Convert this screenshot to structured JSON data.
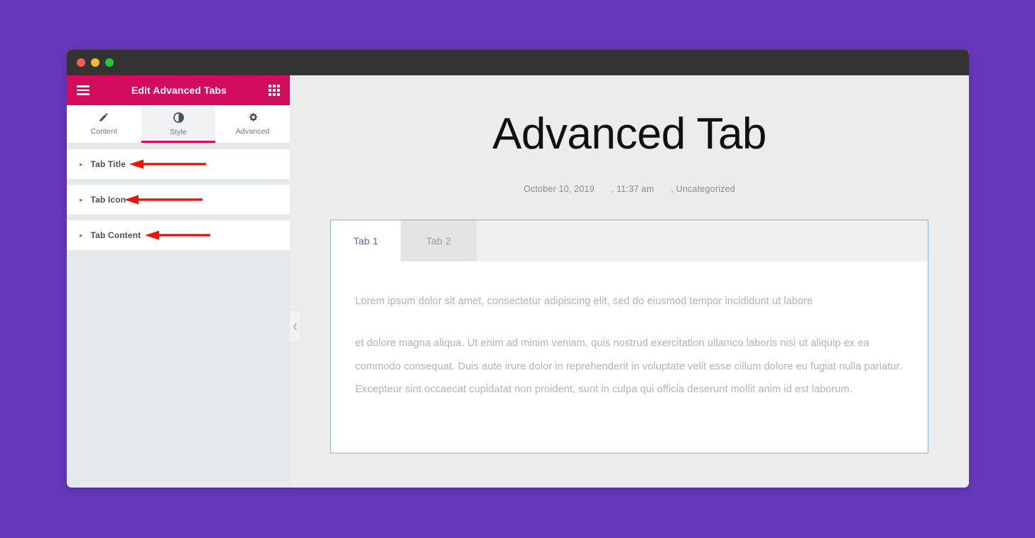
{
  "window": {
    "traffic_lights": [
      "close",
      "minimize",
      "maximize"
    ]
  },
  "panel": {
    "header": {
      "title": "Edit Advanced Tabs",
      "menu_icon": "hamburger-icon",
      "grid_icon": "grid-icon"
    },
    "tabs": [
      {
        "label": "Content",
        "icon": "pencil-icon",
        "active": false
      },
      {
        "label": "Style",
        "icon": "contrast-icon",
        "active": true
      },
      {
        "label": "Advanced",
        "icon": "gear-icon",
        "active": false
      }
    ],
    "sections": [
      {
        "label": "Tab Title",
        "caret": "▸",
        "annotated": true
      },
      {
        "label": "Tab Icon",
        "caret": "▸",
        "annotated": true
      },
      {
        "label": "Tab Content",
        "caret": "▸",
        "annotated": true
      }
    ],
    "collapse_handle_icon": "❮"
  },
  "canvas": {
    "post_title": "Advanced Tab",
    "meta": {
      "date": "October 10, 2019",
      "time": ", 11:37 am",
      "category": ", Uncategorized"
    },
    "widget": {
      "tabs": [
        {
          "label": "Tab 1",
          "active": true
        },
        {
          "label": "Tab 2",
          "active": false
        }
      ],
      "paragraphs": [
        "Lorem ipsum dolor sit amet, consectetur adipiscing elit, sed do eiusmod tempor incididunt ut labore",
        "et dolore magna aliqua. Ut enim ad minim veniam, quis nostrud exercitation ullamco laboris nisi ut aliquip ex ea commodo consequat. Duis aute irure dolor in reprehenderit in voluptate velit esse cillum dolore eu fugiat nulla pariatur. Excepteur sint occaecat cupidatat non proident, sunt in culpa qui officia deserunt mollit anim id est laborum."
      ]
    }
  },
  "colors": {
    "backdrop_purple": "#6639ba",
    "panel_pink": "#d30c5d",
    "selection_blue": "#6ec1e4",
    "active_tab_text": "#6e57e0",
    "annotation_red": "#e8150b"
  }
}
